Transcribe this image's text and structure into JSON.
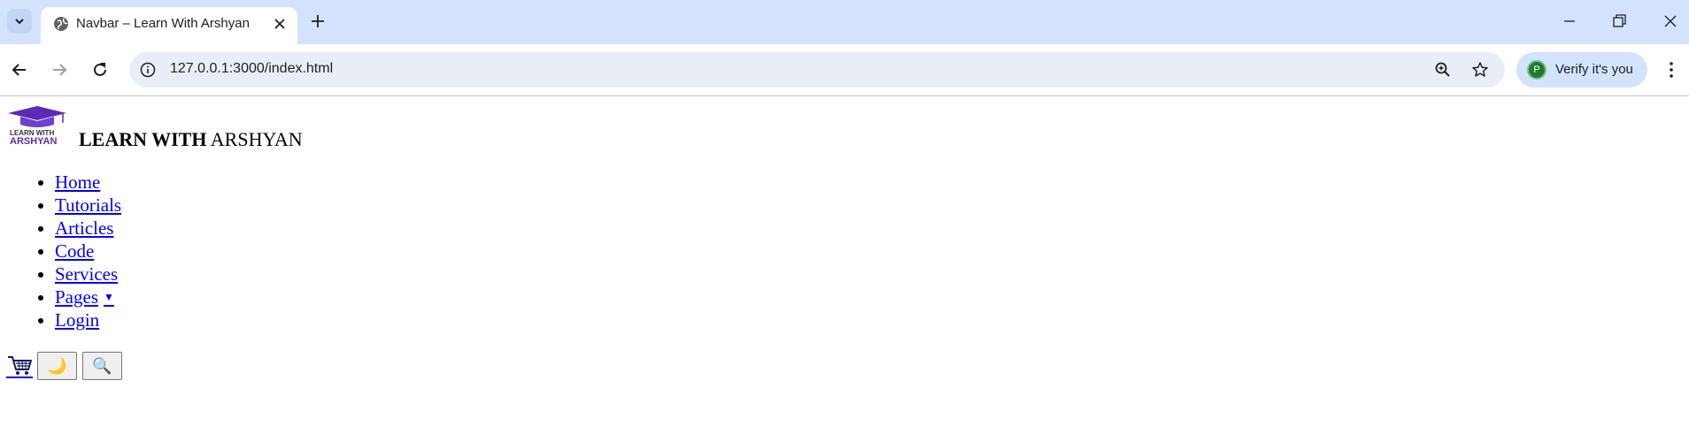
{
  "browser": {
    "tab": {
      "title": "Navbar – Learn With Arshyan"
    },
    "address_bar": {
      "url": "127.0.0.1:3000/index.html"
    },
    "profile": {
      "initial": "P",
      "label": "Verify it's you"
    }
  },
  "page": {
    "logo": {
      "line1": "LEARN WITH",
      "line2": "ARSHYAN"
    },
    "brand": {
      "bold": "LEARN WITH",
      "regular": "ARSHYAN"
    },
    "nav": {
      "items": [
        {
          "label": "Home"
        },
        {
          "label": "Tutorials"
        },
        {
          "label": "Articles"
        },
        {
          "label": "Code"
        },
        {
          "label": "Services"
        },
        {
          "label": "Pages",
          "caret": "▼"
        },
        {
          "label": "Login"
        }
      ]
    },
    "actions": {
      "theme_toggle": "🌙",
      "search": "🔍"
    }
  },
  "colors": {
    "tab_strip": "#d3e3fd",
    "omnibox": "#e9eef6",
    "link": "#0000ee",
    "logo_purple": "#5b2bb5"
  }
}
